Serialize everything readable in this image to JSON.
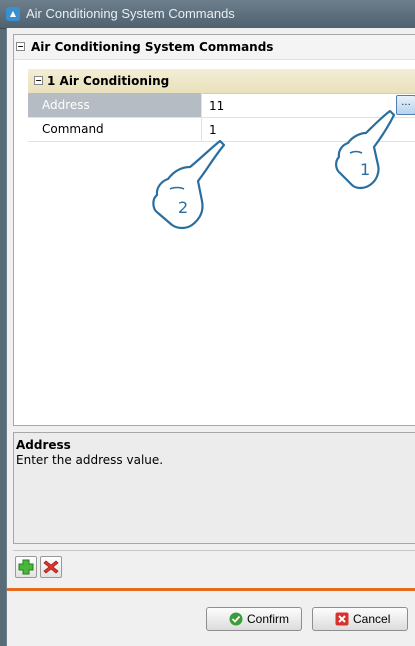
{
  "window": {
    "title": "Air Conditioning System Commands"
  },
  "grid": {
    "header": "Air Conditioning System Commands",
    "section": "1 Air Conditioning",
    "rows": [
      {
        "name": "Address",
        "value": "11"
      },
      {
        "name": "Command",
        "value": "1"
      }
    ],
    "ellipsis_label": "..."
  },
  "description": {
    "title": "Address",
    "text": "Enter the address value."
  },
  "buttons": {
    "confirm": "Confirm",
    "cancel": "Cancel"
  },
  "callouts": {
    "one": "1",
    "two": "2"
  }
}
